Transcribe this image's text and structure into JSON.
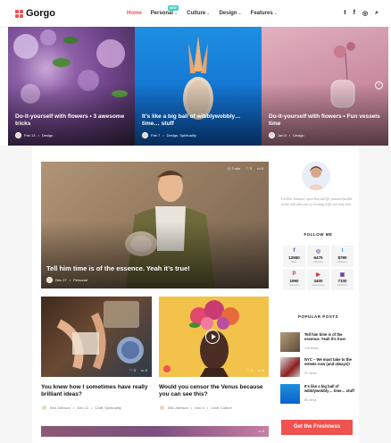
{
  "brand": {
    "name": "Gorgo",
    "accent": "#f0524f",
    "badge_color": "#3ed0c2"
  },
  "nav": {
    "items": [
      {
        "label": "Home",
        "active": true
      },
      {
        "label": "Personal"
      },
      {
        "label": "Culture"
      },
      {
        "label": "Design"
      },
      {
        "label": "Features"
      }
    ],
    "caret": "⌄",
    "new_badge": "NEW"
  },
  "header_social": {
    "twitter": "t",
    "facebook": "f",
    "instagram": "◎",
    "search": "⌕"
  },
  "slides": [
    {
      "title": "Do-it-yourself with flowers • 3 awesome tricks",
      "date": "Feb 13",
      "category": "Design"
    },
    {
      "title": "It’s like a big ball of wibblywobbly… time… stuff",
      "date": "Feb 7",
      "category": "Design, Spirituality"
    },
    {
      "title": "Do-it-yourself with flowers • Fun vessels time",
      "date": "Jan 5",
      "category": "Design"
    }
  ],
  "slider_arrow": "›",
  "featured": {
    "title": "Tell him time is of the essence. Yeah it’s true!",
    "date": "Dec 27",
    "category": "Personal",
    "time": "7 min",
    "likes": "3",
    "comments": "0"
  },
  "cards": [
    {
      "title": "You knew how I sometimes have really brilliant ideas?",
      "author": "Ella Johnson",
      "date": "Dec 13",
      "category": "Craft, Spirituality",
      "likes": "3",
      "comments": "0"
    },
    {
      "title": "Would you censor the Venus because you can see this?",
      "author": "Ella Johnson",
      "date": "Dec 4",
      "category": "Craft, Culture",
      "likes": "3",
      "comments": "0"
    }
  ],
  "bottom_strip": {
    "comments": "0"
  },
  "sidebar": {
    "bio": "I’m Ella Johnson: open-hearted life, passion-fuelled writer and advocate of creating a life you truly love.",
    "follow_heading": "FOLLOW ME",
    "socials": [
      {
        "icon": "f",
        "count": "12550",
        "label": "likes",
        "color": "#3b5998"
      },
      {
        "icon": "◎",
        "count": "6470",
        "label": "followers",
        "color": "#7a4e9c"
      },
      {
        "icon": "t",
        "count": "8790",
        "label": "followers",
        "color": "#1da1f2"
      },
      {
        "icon": "P",
        "count": "1990",
        "label": "followers",
        "color": "#e02a3a"
      },
      {
        "icon": "▶",
        "count": "3400",
        "label": "subscribers",
        "color": "#e02a2a"
      },
      {
        "icon": "▣",
        "count": "7100",
        "label": "followers",
        "color": "#6441a5"
      }
    ],
    "popular_heading": "POPULAR POSTS",
    "popular": [
      {
        "title": "Tell him time is of the essence. Yeah it’s true!",
        "views": "106 views"
      },
      {
        "title": "NYC – We must take to the streets now (and always)!",
        "views": "91 views"
      },
      {
        "title": "It’s like a big ball of wibblywobbly… time… stuff",
        "views": "80 views"
      }
    ],
    "cta": "Get the Freshness"
  }
}
